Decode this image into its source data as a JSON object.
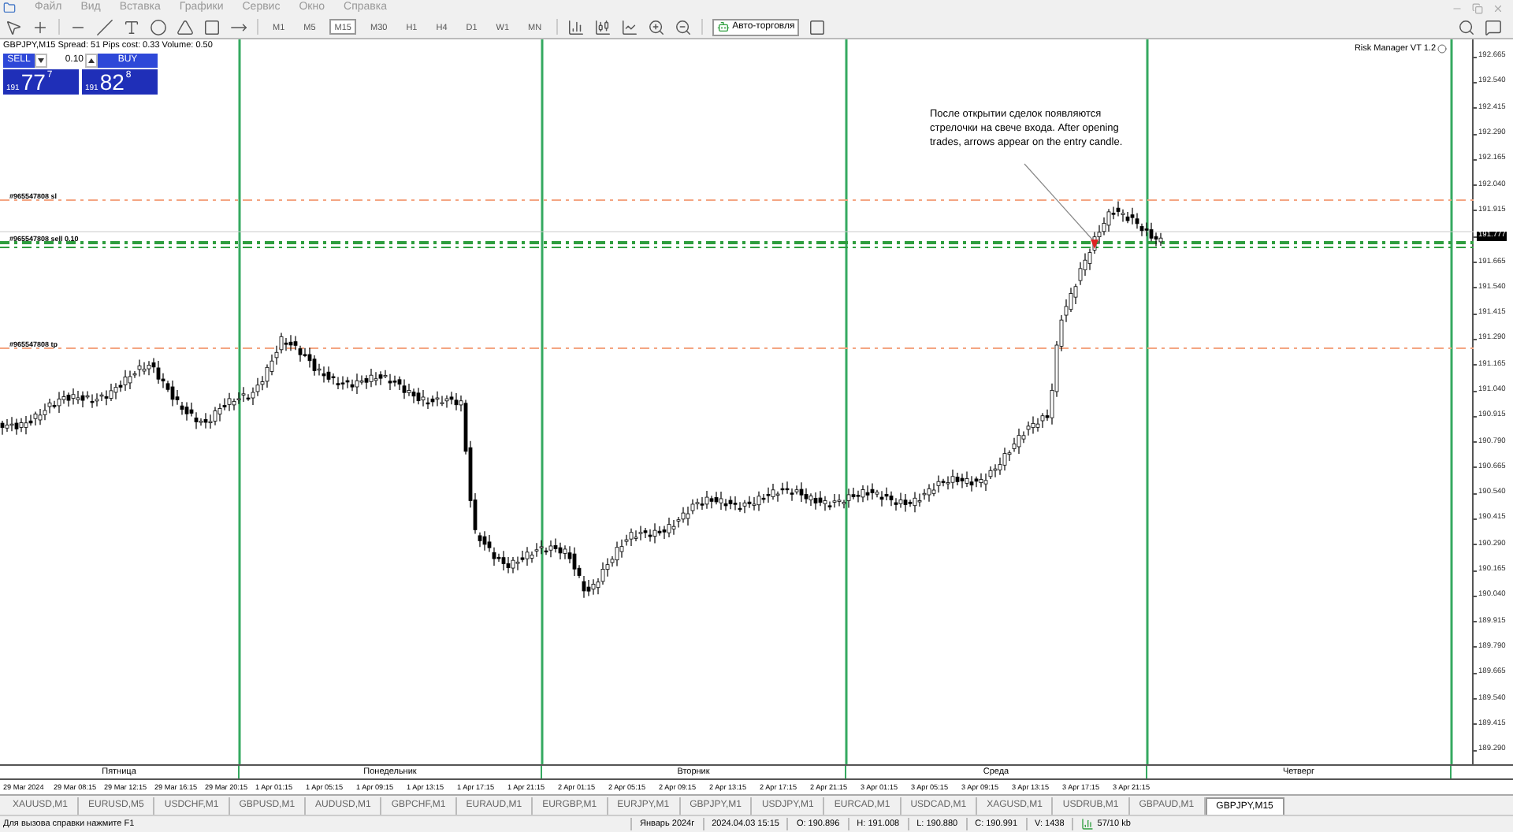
{
  "menu": [
    "Файл",
    "Вид",
    "Вставка",
    "Графики",
    "Сервис",
    "Окно",
    "Справка"
  ],
  "toolbar": {
    "timeframes": [
      {
        "label": "M1",
        "selected": false
      },
      {
        "label": "M5",
        "selected": false
      },
      {
        "label": "M15",
        "selected": true
      },
      {
        "label": "M30",
        "selected": false
      },
      {
        "label": "H1",
        "selected": false
      },
      {
        "label": "H4",
        "selected": false
      },
      {
        "label": "D1",
        "selected": false
      },
      {
        "label": "W1",
        "selected": false
      },
      {
        "label": "MN",
        "selected": false
      }
    ],
    "autotrading": {
      "label": "Авто-торговля",
      "on": true
    }
  },
  "chart": {
    "trade_panel": {
      "info": "GBPJPY,M15  Spread: 51  Pips cost: 0.33  Volume: 0.50",
      "sell_label": "SELL",
      "buy_label": "BUY",
      "lot": "0.10",
      "sell_price": {
        "small": "191",
        "big": "77",
        "sup": "7"
      },
      "buy_price": {
        "small": "191",
        "big": "82",
        "sup": "8"
      }
    },
    "indicator_label": "Risk Manager VT 1.2",
    "note": "После открытии сделок появляются стрелочки на свече входа.  After opening trades, arrows appear on the entry candle.",
    "order_lines": [
      {
        "label": "#965547808 sl",
        "kind": "sl"
      },
      {
        "label": "#965547808 sell 0.10",
        "kind": "entry"
      },
      {
        "label": "#965547808 tp",
        "kind": "tp"
      }
    ],
    "price_axis": [
      {
        "kind": "tick",
        "label": "192.665"
      },
      {
        "kind": "tick",
        "label": "192.540"
      },
      {
        "kind": "tick",
        "label": "192.415"
      },
      {
        "kind": "tick",
        "label": "192.290"
      },
      {
        "kind": "tick",
        "label": "192.165"
      },
      {
        "kind": "tick",
        "label": "192.040"
      },
      {
        "kind": "tick",
        "label": "191.915"
      },
      {
        "kind": "current",
        "label": "191.777"
      },
      {
        "kind": "tick",
        "label": "191.665"
      },
      {
        "kind": "tick",
        "label": "191.540"
      },
      {
        "kind": "tick",
        "label": "191.415"
      },
      {
        "kind": "tick",
        "label": "191.290"
      },
      {
        "kind": "tick",
        "label": "191.165"
      },
      {
        "kind": "tick",
        "label": "191.040"
      },
      {
        "kind": "tick",
        "label": "190.915"
      },
      {
        "kind": "tick",
        "label": "190.790"
      },
      {
        "kind": "tick",
        "label": "190.665"
      },
      {
        "kind": "tick",
        "label": "190.540"
      },
      {
        "kind": "tick",
        "label": "190.415"
      },
      {
        "kind": "tick",
        "label": "190.290"
      },
      {
        "kind": "tick",
        "label": "190.165"
      },
      {
        "kind": "tick",
        "label": "190.040"
      },
      {
        "kind": "tick",
        "label": "189.915"
      },
      {
        "kind": "tick",
        "label": "189.790"
      },
      {
        "kind": "tick",
        "label": "189.665"
      },
      {
        "kind": "tick",
        "label": "189.540"
      },
      {
        "kind": "tick",
        "label": "189.415"
      },
      {
        "kind": "tick",
        "label": "189.290"
      }
    ],
    "day_labels": [
      "Пятница",
      "Понедельник",
      "Вторник",
      "Среда",
      "Четверг"
    ],
    "time_labels": [
      "29 Mar 2024",
      "29 Mar 08:15",
      "29 Mar 12:15",
      "29 Mar 16:15",
      "29 Mar 20:15",
      "1 Apr 01:15",
      "1 Apr 05:15",
      "1 Apr 09:15",
      "1 Apr 13:15",
      "1 Apr 17:15",
      "1 Apr 21:15",
      "2 Apr 01:15",
      "2 Apr 05:15",
      "2 Apr 09:15",
      "2 Apr 13:15",
      "2 Apr 17:15",
      "2 Apr 21:15",
      "3 Apr 01:15",
      "3 Apr 05:15",
      "3 Apr 09:15",
      "3 Apr 13:15",
      "3 Apr 17:15",
      "3 Apr 21:15"
    ]
  },
  "symbol_tabs": [
    {
      "label": "XAUUSD,M1",
      "selected": false
    },
    {
      "label": "EURUSD,M5",
      "selected": false
    },
    {
      "label": "USDCHF,M1",
      "selected": false
    },
    {
      "label": "GBPUSD,M1",
      "selected": false
    },
    {
      "label": "AUDUSD,M1",
      "selected": false
    },
    {
      "label": "GBPCHF,M1",
      "selected": false
    },
    {
      "label": "EURAUD,M1",
      "selected": false
    },
    {
      "label": "EURGBP,M1",
      "selected": false
    },
    {
      "label": "EURJPY,M1",
      "selected": false
    },
    {
      "label": "GBPJPY,M1",
      "selected": false
    },
    {
      "label": "USDJPY,M1",
      "selected": false
    },
    {
      "label": "EURCAD,M1",
      "selected": false
    },
    {
      "label": "USDCAD,M1",
      "selected": false
    },
    {
      "label": "XAGUSD,M1",
      "selected": false
    },
    {
      "label": "USDRUB,M1",
      "selected": false
    },
    {
      "label": "GBPAUD,M1",
      "selected": false
    },
    {
      "label": "GBPJPY,M15",
      "selected": true
    }
  ],
  "status_bar": {
    "help": "Для вызова справки нажмите F1",
    "cells": [
      "Январь 2024г",
      "2024.04.03 15:15",
      "O: 190.896",
      "H: 191.008",
      "L: 190.880",
      "C: 190.991",
      "V: 1438"
    ],
    "traffic": "57/10 kb"
  }
}
